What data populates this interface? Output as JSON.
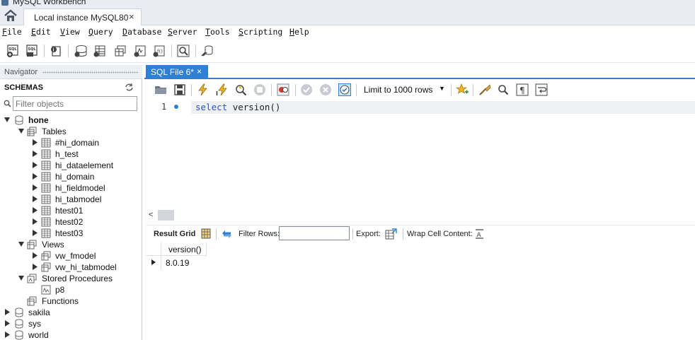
{
  "window": {
    "title": "MySQL Workbench"
  },
  "tabs": {
    "connection": "Local instance MySQL80",
    "close": "×"
  },
  "menu": [
    {
      "label": "File",
      "mnemonic": "F",
      "rest": "ile"
    },
    {
      "label": "Edit",
      "mnemonic": "E",
      "rest": "dit"
    },
    {
      "label": "View",
      "mnemonic": "V",
      "rest": "iew"
    },
    {
      "label": "Query",
      "mnemonic": "Q",
      "rest": "uery"
    },
    {
      "label": "Database",
      "mnemonic": "D",
      "rest": "atabase"
    },
    {
      "label": "Server",
      "mnemonic": "S",
      "rest": "erver"
    },
    {
      "label": "Tools",
      "mnemonic": "T",
      "rest": "ools"
    },
    {
      "label": "Scripting",
      "mnemonic": "S",
      "rest": "cripting"
    },
    {
      "label": "Help",
      "mnemonic": "H",
      "rest": "elp"
    }
  ],
  "navigator": {
    "title": "Navigator",
    "schemas_label": "SCHEMAS",
    "filter_placeholder": "Filter objects",
    "tree": {
      "hone": "hone",
      "tables": "Tables",
      "table_items": [
        "#hi_domain",
        "h_test",
        "hi_dataelement",
        "hi_domain",
        "hi_fieldmodel",
        "hi_tabmodel",
        "htest01",
        "htest02",
        "htest03"
      ],
      "views": "Views",
      "view_items": [
        "vw_fmodel",
        "vw_hi_tabmodel"
      ],
      "stored_procedures": "Stored Procedures",
      "procedure_items": [
        "p8"
      ],
      "functions": "Functions",
      "other_schemas": [
        "sakila",
        "sys",
        "world"
      ]
    }
  },
  "editor": {
    "tab_label": "SQL File 6*",
    "tab_close": "×",
    "limit_label": "Limit to 1000 rows",
    "line_number": "1",
    "sql_keyword": "select",
    "sql_rest": "version()"
  },
  "results": {
    "result_grid_label": "Result Grid",
    "filter_rows_label": "Filter Rows:",
    "export_label": "Export:",
    "wrap_label": "Wrap Cell Content:",
    "column": "version()",
    "value": "8.0.19"
  },
  "colors": {
    "accent": "#2f7fd3",
    "keyword": "#2a55c8"
  }
}
